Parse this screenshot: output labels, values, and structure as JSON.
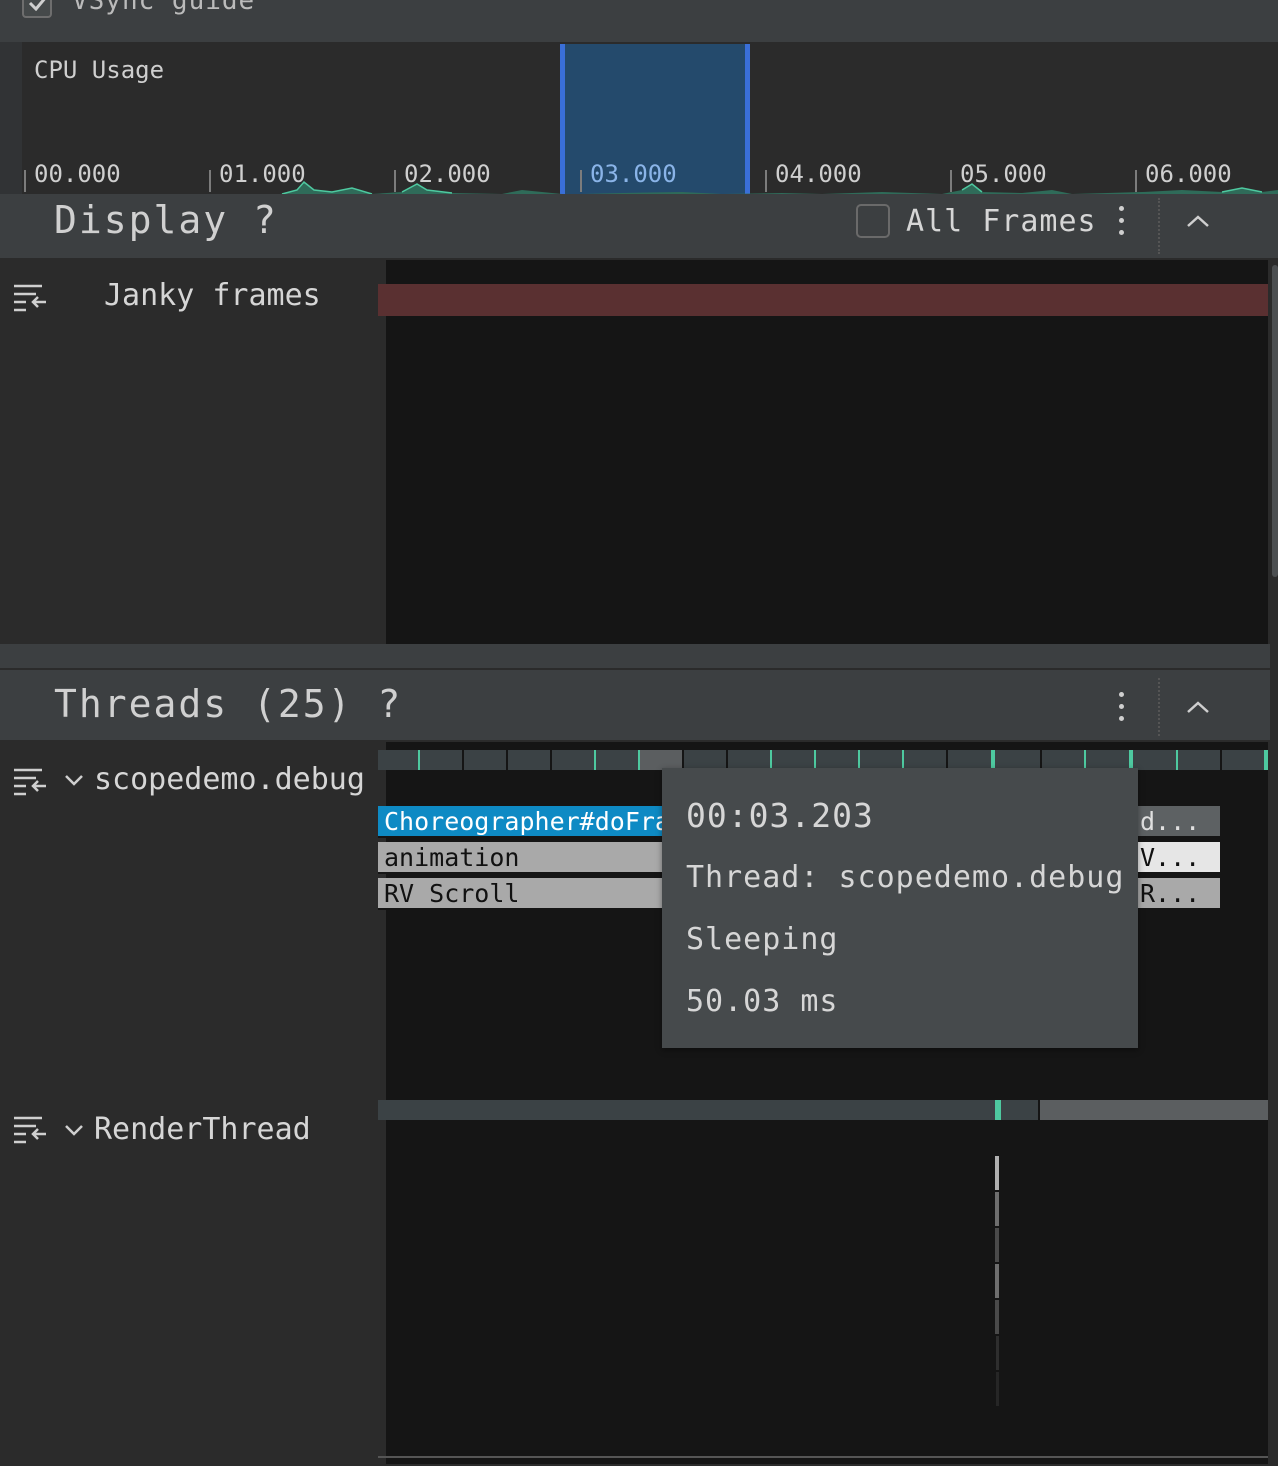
{
  "top": {
    "vsync_label": "VSync guide",
    "vsync_checked": true
  },
  "cpu": {
    "label": "CPU Usage",
    "ticks": [
      "00.000",
      "01.000",
      "02.000",
      "03.000",
      "04.000",
      "05.000",
      "06.000"
    ],
    "selected_tick": "03.000"
  },
  "display": {
    "title": "Display ?",
    "all_frames_label": "All Frames",
    "all_frames_checked": false,
    "tracks": [
      {
        "label": "Janky frames"
      }
    ]
  },
  "threads": {
    "title": "Threads (25) ?",
    "items": [
      {
        "name": "scopedemo.debug",
        "slices": [
          "Choreographer#doFrame",
          "animation",
          "RV Scroll"
        ],
        "slices_truncated": [
          "d...",
          "V...",
          "R..."
        ]
      },
      {
        "name": "RenderThread"
      }
    ]
  },
  "tooltip": {
    "time": "00:03.203",
    "thread": "Thread: scopedemo.debug",
    "state": "Sleeping",
    "duration": "50.03 ms"
  },
  "colors": {
    "selection_fill": "#244a6c",
    "selection_border": "#3a6fd8",
    "janky": "#5a3031",
    "running": "#4ec9a0",
    "slice_blue": "#0e8ac4",
    "slice_gray": "#a9a9a9"
  }
}
